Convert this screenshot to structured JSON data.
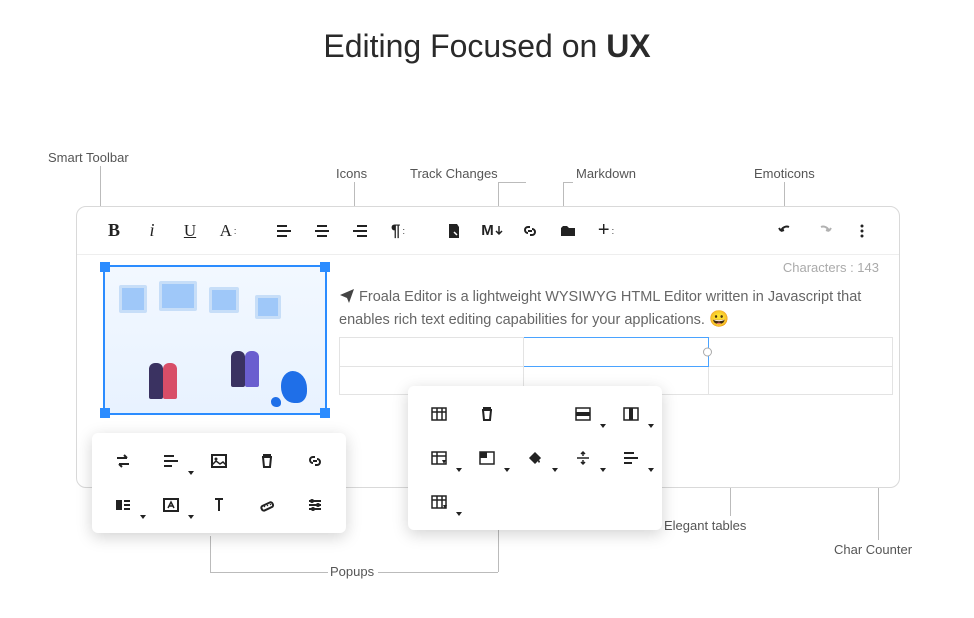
{
  "heading": {
    "prefix": "Editing Focused on ",
    "bold": "UX"
  },
  "callouts": {
    "smart_toolbar": "Smart Toolbar",
    "icons": "Icons",
    "track_changes": "Track Changes",
    "markdown": "Markdown",
    "emoticons": "Emoticons",
    "popups": "Popups",
    "elegant_tables": "Elegant tables",
    "char_counter": "Char Counter"
  },
  "content_text": "Froala Editor is a lightweight WYSIWYG HTML Editor written in Javascript that enables rich text editing capabilities for your applications.",
  "char_label": "Characters : ",
  "char_count": "143",
  "emoji": "😀",
  "toolbar": {
    "bold": "B",
    "italic": "i"
  }
}
